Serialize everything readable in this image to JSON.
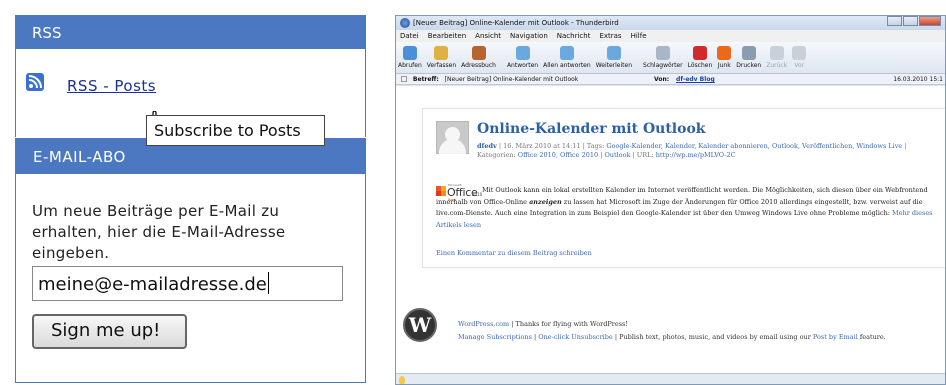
{
  "sidebar": {
    "rss_title": "RSS",
    "rss_link": "RSS - Posts",
    "tooltip": "Subscribe to Posts",
    "email_title": "E-MAIL-ABO",
    "email_text": "Um neue Beiträge per E-Mail zu erhalten, hier die E-Mail-Adresse eingeben.",
    "email_value": "meine@e-mailadresse.de",
    "signup_button": "Sign me up!"
  },
  "window": {
    "title": "[Neuer Beitrag] Online-Kalender mit Outlook - Thunderbird",
    "menu": [
      "Datei",
      "Bearbeiten",
      "Ansicht",
      "Navigation",
      "Nachricht",
      "Extras",
      "Hilfe"
    ],
    "toolbar": [
      {
        "label": "Abrufen",
        "icon": "download-mail-icon",
        "color": "#4a8fd8"
      },
      {
        "label": "Verfassen",
        "icon": "compose-pen-icon",
        "color": "#e0b040"
      },
      {
        "label": "Adressbuch",
        "icon": "address-book-icon",
        "color": "#b8642e"
      },
      {
        "label": "Antworten",
        "icon": "reply-icon",
        "color": "#6aa8e0"
      },
      {
        "label": "Allen antworten",
        "icon": "reply-all-icon",
        "color": "#6aa8e0"
      },
      {
        "label": "Weiterleiten",
        "icon": "forward-icon",
        "color": "#6aa8e0"
      },
      {
        "label": "Schlagwörter",
        "icon": "tag-icon",
        "color": "#a9b6c8"
      },
      {
        "label": "Löschen",
        "icon": "delete-x-icon",
        "color": "#d02a2a"
      },
      {
        "label": "Junk",
        "icon": "junk-flame-icon",
        "color": "#e86a1a"
      },
      {
        "label": "Drucken",
        "icon": "print-icon",
        "color": "#8b9bb0"
      },
      {
        "label": "Zurück",
        "icon": "back-arrow-icon",
        "color": "#c8d0da",
        "disabled": true
      },
      {
        "label": "Vor",
        "icon": "forward-arrow-icon",
        "color": "#c8d0da",
        "disabled": true
      }
    ],
    "header": {
      "subject_label": "Betreff:",
      "subject": "[Neuer Beitrag] Online-Kalender mit Outlook",
      "from_label": "Von:",
      "from": "df-edv Blog",
      "date": "16.03.2010 15:1"
    }
  },
  "post": {
    "title": "Online-Kalender mit Outlook",
    "author": "dfedv",
    "meta_date": " | 16. März 2010 at 14:11 | Tags: ",
    "tags": "Google-Kalender, Kalender, Kalender abonnieren, Outlook, Veröffentlichen, Windows Live",
    "meta_cat_label": " | Kategorien: ",
    "categories": "Office 2010, Office 2010 | Outlook",
    "meta_url_label": " | URL: ",
    "url": "http://wp.me/pMLVO-2C",
    "logo_ms": "Microsoft",
    "logo_office": "Office",
    "logo_year": "2010",
    "logo_beta": "Beta",
    "body_1": "Mit Outlook kann ein lokal erstellten Kalender im Internet veröffentlicht werden. Die Möglichkeiten, sich diesen über ein Webfrontend innerhalb von Office-Online ",
    "body_em": "anzeigen",
    "body_2": " zu lassen hat Microsoft im Zuge der Änderungen für Office 2010 allerdings eingestellt, bzw. verweist auf die live.com-Dienste. Auch eine Integration in zum Beispiel den Google-Kalender ist über den Umweg Windows Live ohne Probleme möglich: ",
    "read_more": "Mehr dieses Artikels lesen",
    "comment_link": "Einen Kommentar zu diesem Beitrag schreiben"
  },
  "footer": {
    "wp_link": "WordPress.com",
    "thanks": " | Thanks for flying with WordPress!",
    "manage": "Manage Subscriptions",
    "sep": " | ",
    "unsubscribe": "One-click Unsubscribe",
    "publish_text": " | Publish text, photos, music, and videos by email using our ",
    "post_by_email": "Post by Email",
    "feature": " feature."
  }
}
